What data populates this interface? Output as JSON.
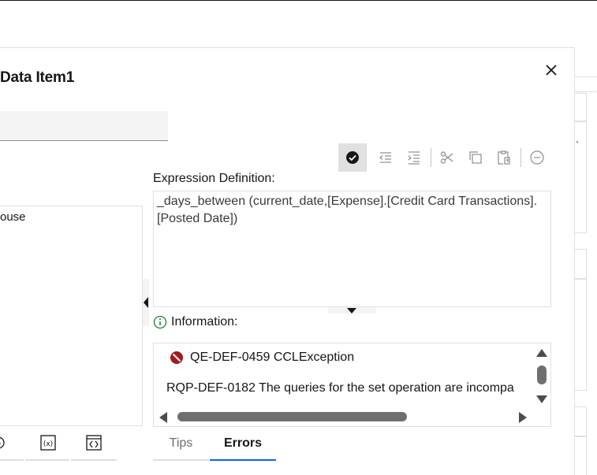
{
  "dialog": {
    "title": "Data Item1",
    "name_value": ""
  },
  "tree": {
    "items": [
      "ouse"
    ]
  },
  "toolbar": {
    "buttons": [
      {
        "icon": "checkmark-filled-icon",
        "active": true
      },
      {
        "icon": "indent-less-icon"
      },
      {
        "icon": "indent-more-icon"
      },
      {
        "icon": "cut-icon"
      },
      {
        "icon": "copy-icon"
      },
      {
        "icon": "paste-icon"
      },
      {
        "icon": "subtract-circle-icon"
      }
    ]
  },
  "expression": {
    "label": "Expression Definition:",
    "value": "_days_between (current_date,[Expense].[Credit Card Transactions].[Posted Date])"
  },
  "information": {
    "label": "Information:",
    "error_code": "QE-DEF-0459 CCLException",
    "error_message": "RQP-DEF-0182 The queries for the set operation are incompa"
  },
  "tabs": {
    "tips": "Tips",
    "errors": "Errors",
    "active": "errors"
  },
  "colors": {
    "accent": "#0f62fe",
    "error": "#a2191f",
    "info": "#198038"
  }
}
